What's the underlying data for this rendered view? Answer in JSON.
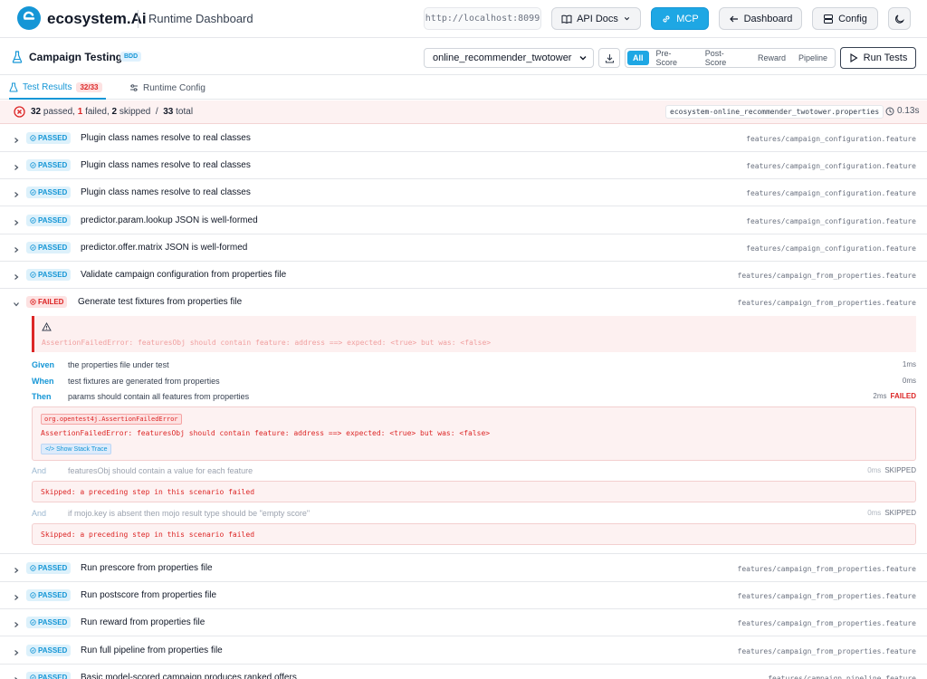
{
  "header": {
    "brand": "ecosystem.Ai",
    "subtitle": "Runtime Dashboard",
    "url": "http://localhost:8099",
    "api_docs": "API Docs",
    "mcp": "MCP",
    "dashboard": "Dashboard",
    "config": "Config"
  },
  "subheader": {
    "title": "Campaign Testing",
    "badge": "BDD",
    "selected_campaign": "online_recommender_twotower",
    "filters": [
      "All",
      "Pre-Score",
      "Post-Score",
      "Reward",
      "Pipeline"
    ],
    "active_filter": "All",
    "run_tests": "Run Tests"
  },
  "tabs": {
    "results_label": "Test Results",
    "results_count": "32/33",
    "config_label": "Runtime Config"
  },
  "summary": {
    "passed": "32",
    "passed_label": "passed,",
    "failed": "1",
    "failed_label": "failed,",
    "skipped": "2",
    "skipped_label": "skipped",
    "slash": "/",
    "total": "33",
    "total_label": "total",
    "properties_file": "ecosystem-online_recommender_twotower.properties",
    "duration": "0.13s"
  },
  "rows_before": [
    {
      "status": "PASSED",
      "title": "Plugin class names resolve to real classes",
      "file": "features/campaign_configuration.feature"
    },
    {
      "status": "PASSED",
      "title": "Plugin class names resolve to real classes",
      "file": "features/campaign_configuration.feature"
    },
    {
      "status": "PASSED",
      "title": "Plugin class names resolve to real classes",
      "file": "features/campaign_configuration.feature"
    },
    {
      "status": "PASSED",
      "title": "predictor.param.lookup JSON is well-formed",
      "file": "features/campaign_configuration.feature"
    },
    {
      "status": "PASSED",
      "title": "predictor.offer.matrix JSON is well-formed",
      "file": "features/campaign_configuration.feature"
    },
    {
      "status": "PASSED",
      "title": "Validate campaign configuration from properties file",
      "file": "features/campaign_from_properties.feature"
    },
    {
      "status": "FAILED",
      "title": "Generate test fixtures from properties file",
      "file": "features/campaign_from_properties.feature"
    }
  ],
  "failure": {
    "top_message": "AssertionFailedError: featuresObj should contain feature: address ==> expected: <true> but was: <false>",
    "steps": [
      {
        "kw": "Given",
        "text": "the properties file under test",
        "ms": "1ms",
        "status": ""
      },
      {
        "kw": "When",
        "text": "test fixtures are generated from properties",
        "ms": "0ms",
        "status": ""
      },
      {
        "kw": "Then",
        "text": "params should contain all features from properties",
        "ms": "2ms",
        "status": "FAILED"
      }
    ],
    "error_class": "org.opentest4j.AssertionFailedError",
    "error_message": "AssertionFailedError: featuresObj should contain feature: address ==> expected: <true> but was: <false>",
    "stack_trace_label": "</> Show Stack Trace",
    "skipped_steps": [
      {
        "kw": "And",
        "text": "featuresObj should contain a value for each feature",
        "ms": "0ms",
        "status": "SKIPPED",
        "message": "Skipped: a preceding step in this scenario failed"
      },
      {
        "kw": "And",
        "text": "if mojo.key is absent then mojo result type should be \"empty score\"",
        "ms": "0ms",
        "status": "SKIPPED",
        "message": "Skipped: a preceding step in this scenario failed"
      }
    ]
  },
  "rows_after": [
    {
      "status": "PASSED",
      "title": "Run prescore from properties file",
      "file": "features/campaign_from_properties.feature"
    },
    {
      "status": "PASSED",
      "title": "Run postscore from properties file",
      "file": "features/campaign_from_properties.feature"
    },
    {
      "status": "PASSED",
      "title": "Run reward from properties file",
      "file": "features/campaign_from_properties.feature"
    },
    {
      "status": "PASSED",
      "title": "Run full pipeline from properties file",
      "file": "features/campaign_from_properties.feature"
    },
    {
      "status": "PASSED",
      "title": "Basic model-scored campaign produces ranked offers",
      "file": "features/campaign_pipeline.feature"
    }
  ],
  "colors": {
    "accent": "#1ea7e4",
    "fail": "#dc2626"
  }
}
